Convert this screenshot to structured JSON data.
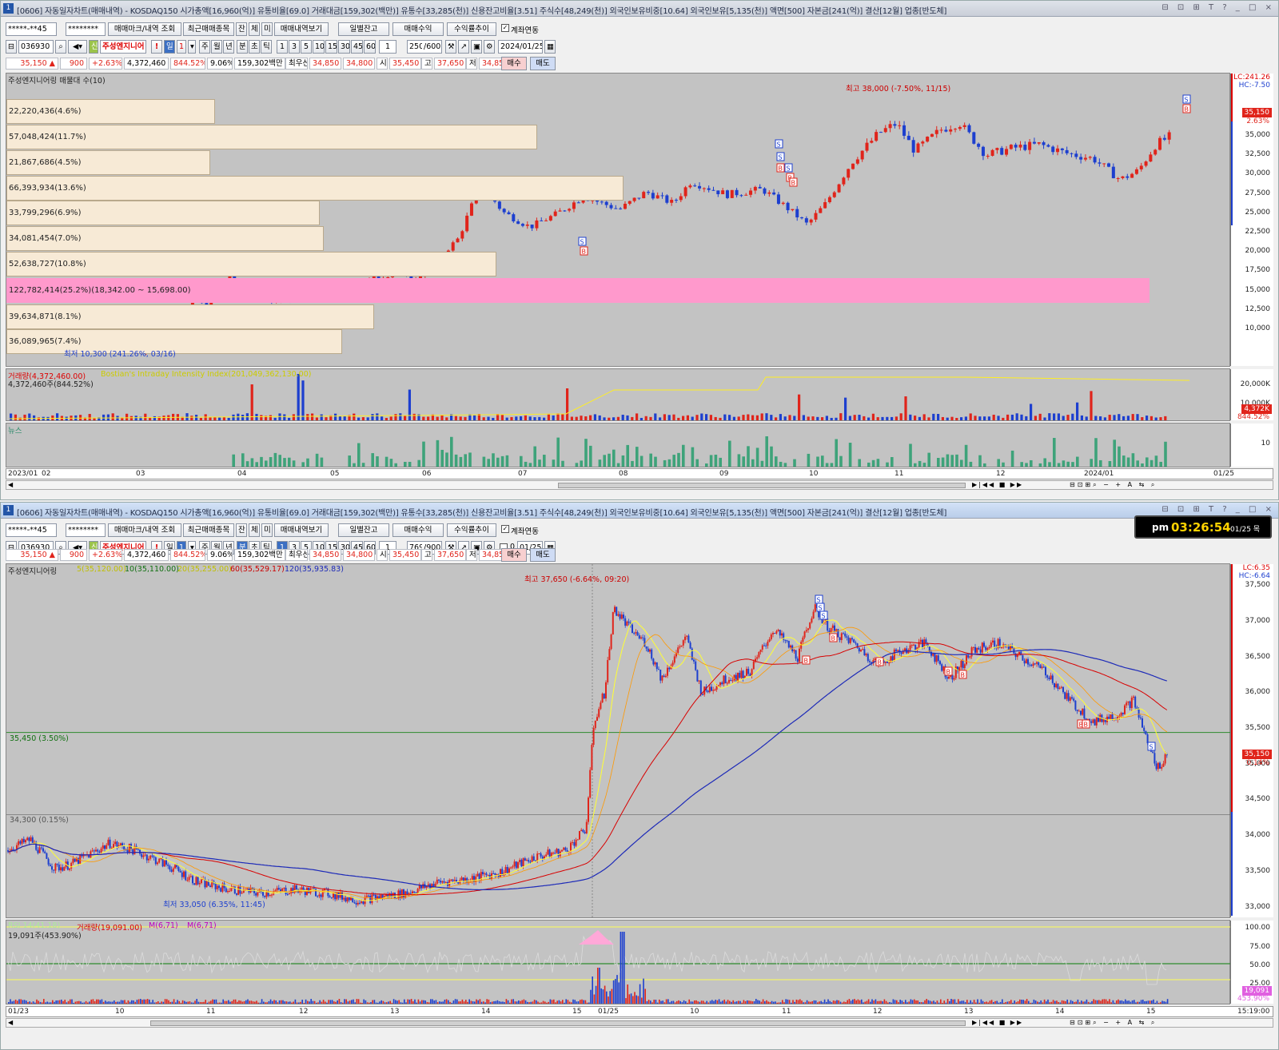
{
  "window1": {
    "num": "1",
    "title": "[0606] 자동일자차트(매매내역) - KOSDAQ150 시가총액[16,960(억)] 유통비율[69.0] 거래대금[159,302(백만)] 유통수[33,285(천)] 신용잔고비율[3.51] 주식수[48,249(천)] 외국인보유비중[10.64] 외국인보유[5,135(천)] 액면[500] 자본금[241(억)] 결산[12월] 업종[반도체]",
    "controls": "⊟ ⊡ ⊞ T ? _ □ ×",
    "toolbar": {
      "account": "*****-**45",
      "password": "********",
      "btn_mark": "매매마크/내역 조회",
      "btn_recent": "최근매매종목",
      "btn_jan": "잔",
      "btn_che": "체",
      "btn_mi": "미",
      "btn_view": "매매내역보기",
      "btn_daily": "일별잔고",
      "btn_profit": "매매수익",
      "btn_rate": "수익률추이",
      "chk_link": "계좌연동"
    },
    "toolbar2": {
      "code": "036930",
      "sin": "신",
      "name": "주성엔지니어",
      "excl": "!",
      "il": "일",
      "one": "1",
      "ju": "주",
      "wol": "월",
      "nyeon": "년",
      "bun": "분",
      "cho": "초",
      "tik": "틱",
      "nums": [
        "1",
        "3",
        "5",
        "10",
        "15",
        "30",
        "45",
        "60"
      ],
      "n1": "1",
      "count": "250",
      "total": "/600",
      "date": "2024/01/25"
    },
    "price": {
      "price": "35,150 ▲",
      "chg": "900",
      "pct": "+2.63%",
      "vol": "4,372,460",
      "volpct": "844.52%",
      "turn": "9.06%",
      "amt": "159,302백만",
      "bid_lbl": "최우선",
      "bid": "34,850",
      "ask": "34,800",
      "open_lbl": "시",
      "open": "35,450",
      "high_lbl": "고",
      "high": "37,650",
      "low_lbl": "저",
      "low": "34,850",
      "buy": "매수",
      "sell": "매도"
    },
    "chart_title": "주성엔지니어링 매물대 수(10)",
    "profile": [
      {
        "label": "22,220,436(4.6%)",
        "pct": 4.6
      },
      {
        "label": "57,048,424(11.7%)",
        "pct": 11.7
      },
      {
        "label": "21,867,686(4.5%)",
        "pct": 4.5
      },
      {
        "label": "66,393,934(13.6%)",
        "pct": 13.6
      },
      {
        "label": "33,799,296(6.9%)",
        "pct": 6.9
      },
      {
        "label": "34,081,454(7.0%)",
        "pct": 7.0
      },
      {
        "label": "52,638,727(10.8%)",
        "pct": 10.8
      },
      {
        "label": "122,782,414(25.2%)(18,342.00 ~ 15,698.00)",
        "pct": 25.2
      },
      {
        "label": "39,634,871(8.1%)",
        "pct": 8.1
      },
      {
        "label": "36,089,965(7.4%)",
        "pct": 7.4
      }
    ],
    "ann_high": "최고 38,000 (-7.50%, 11/15)",
    "ann_low": "최저 10,300 (241.26%, 03/16)",
    "yticks": [
      "35,000",
      "32,500",
      "30,000",
      "27,500",
      "25,000",
      "22,500",
      "20,000",
      "17,500",
      "15,000",
      "12,500",
      "10,000"
    ],
    "lc": "LC:241.26",
    "hc": "HC:-7.50",
    "tag_price": "35,150",
    "tag_pct": "2.63%",
    "vol_title": "거래량(4,372,460.00)",
    "vol_ind": "Bostian's Intraday Intensity Index(201,049,362,130.00)",
    "vol_val": "4,372,460주(844.52%)",
    "vol_ticks": [
      "20,000K",
      "10,000K"
    ],
    "vol_tag1": "4,372K",
    "vol_tag2": "844.52%",
    "news_title": "뉴스",
    "news_tick": "10",
    "xlabels": [
      "2023/01",
      "02",
      "03",
      "04",
      "05",
      "06",
      "07",
      "08",
      "09",
      "10",
      "11",
      "12",
      "2024/01",
      "01/25"
    ]
  },
  "window2": {
    "num": "1",
    "title": "[0606] 자동일자차트(매매내역) - KOSDAQ150 시가총액[16,960(억)] 유통비율[69.0] 거래대금[159,302(백만)] 유통수[33,285(천)] 신용잔고비율[3.51] 주식수[48,249(천)] 외국인보유비중[10.64] 외국인보유[5,135(천)] 액면[500] 자본금[241(억)] 결산[12월] 업종[반도체]",
    "controls": "⊟ ⊡ ⊞ T ? _ □ ×",
    "toolbar": {
      "account": "*****-**45",
      "password": "********",
      "btn_mark": "매매마크/내역 조회",
      "btn_recent": "최근매매종목",
      "btn_jan": "잔",
      "btn_che": "체",
      "btn_mi": "미",
      "btn_view": "매매내역보기",
      "btn_daily": "일별잔고",
      "btn_profit": "매매수익",
      "btn_rate": "수익률추이",
      "chk_link": "계좌연동"
    },
    "toolbar2": {
      "code": "036930",
      "sin": "신",
      "name": "주성엔지니어",
      "excl": "!",
      "il": "일",
      "one": "1",
      "ju": "주",
      "wol": "월",
      "nyeon": "년",
      "bun": "분",
      "cho": "초",
      "tik": "틱",
      "nums": [
        "1",
        "3",
        "5",
        "10",
        "15",
        "30",
        "45",
        "60"
      ],
      "n1": "1",
      "count": "769",
      "total": "/900",
      "zero": "0",
      "date": "01/25"
    },
    "clock": {
      "ampm": "pm",
      "time": "03:26:54",
      "date": "01/25 목"
    },
    "price": {
      "price": "35,150 ▲",
      "chg": "900",
      "pct": "+2.63%",
      "vol": "4,372,460",
      "volpct": "844.52%",
      "turn": "9.06%",
      "amt": "159,302백만",
      "bid_lbl": "최우선",
      "bid": "34,850",
      "ask": "34,800",
      "open_lbl": "시",
      "open": "35,450",
      "high_lbl": "고",
      "high": "37,650",
      "low_lbl": "저",
      "low": "34,850",
      "buy": "매수",
      "sell": "매도"
    },
    "chart_title": "주성엔지니어링",
    "ma": {
      "ma5": "5(35,120.00)",
      "ma10": "10(35,110.00)",
      "ma20": "20(35,255.00)",
      "ma60": "60(35,529.17)",
      "ma120": "120(35,935.83)"
    },
    "ann_high": "최고 37,650 (-6.64%, 09:20)",
    "ann_low": "최저 33,050 (6.35%, 11:45)",
    "hline1": "35,450 (3.50%)",
    "hline2": "34,300 (0.15%)",
    "yticks": [
      "37,500",
      "37,000",
      "36,500",
      "36,000",
      "35,500",
      "35,000",
      "34,500",
      "34,000",
      "33,500",
      "33,000"
    ],
    "lc": "LC:6.35",
    "hc": "HC:-6.64",
    "tag_price": "35,150",
    "tag_pct": "0.14%",
    "rsi_title": "RSI 14(41.18)",
    "vol_title": "거래량(19,091.00)",
    "m1": "M(6,71)",
    "m2": "M(6,71)",
    "vol_val": "19,091주(453.90%)",
    "rsi_ticks": [
      "100.00",
      "75.00",
      "50.00",
      "25.00"
    ],
    "vol_tag1": "19,091",
    "vol_tag2": "453.90%",
    "xlabels": [
      "01/23",
      "10",
      "11",
      "12",
      "13",
      "14",
      "15",
      "01/25",
      "10",
      "11",
      "12",
      "13",
      "14",
      "15",
      "15:19:00"
    ]
  },
  "colors": {
    "up": "#e0241b",
    "down": "#1d3fcf",
    "chart_bg": "#c3c3c3",
    "profile": "#f7ead6",
    "profile_peak": "#ff99cc",
    "ma5": "#ffff00",
    "ma20": "#d80000",
    "ma60": "#1d2ab8"
  },
  "icons": [
    "search-icon",
    "speaker-icon",
    "lock-icon",
    "save-icon",
    "gear-icon",
    "calendar-icon"
  ]
}
